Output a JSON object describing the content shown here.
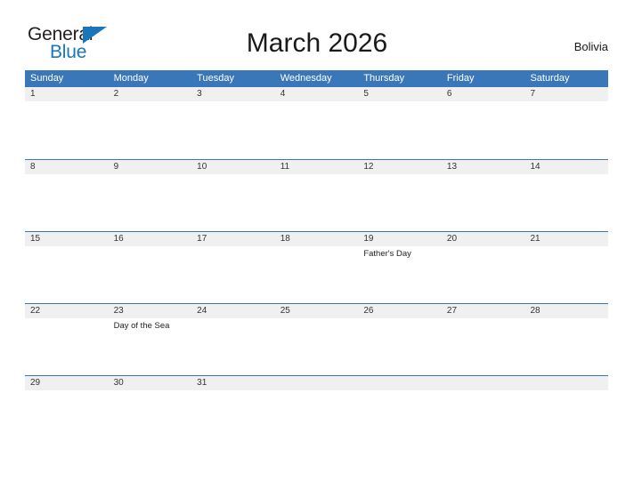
{
  "brand": {
    "name_top": "General",
    "name_bottom": "Blue",
    "accent_color": "#1b75bb",
    "flag_icon": "flag-triangle-icon"
  },
  "header": {
    "title": "March 2026",
    "country": "Bolivia"
  },
  "colors": {
    "header_blue": "#3a77b8",
    "row_line_blue": "#3a77b8",
    "date_band_gray": "#f0f0f0",
    "text_dark": "#1a1a1a"
  },
  "calendar": {
    "month": "March",
    "year": "2026",
    "weekdays": [
      "Sunday",
      "Monday",
      "Tuesday",
      "Wednesday",
      "Thursday",
      "Friday",
      "Saturday"
    ],
    "weeks": [
      [
        {
          "date": "1",
          "events": []
        },
        {
          "date": "2",
          "events": []
        },
        {
          "date": "3",
          "events": []
        },
        {
          "date": "4",
          "events": []
        },
        {
          "date": "5",
          "events": []
        },
        {
          "date": "6",
          "events": []
        },
        {
          "date": "7",
          "events": []
        }
      ],
      [
        {
          "date": "8",
          "events": []
        },
        {
          "date": "9",
          "events": []
        },
        {
          "date": "10",
          "events": []
        },
        {
          "date": "11",
          "events": []
        },
        {
          "date": "12",
          "events": []
        },
        {
          "date": "13",
          "events": []
        },
        {
          "date": "14",
          "events": []
        }
      ],
      [
        {
          "date": "15",
          "events": []
        },
        {
          "date": "16",
          "events": []
        },
        {
          "date": "17",
          "events": []
        },
        {
          "date": "18",
          "events": []
        },
        {
          "date": "19",
          "events": [
            "Father's Day"
          ]
        },
        {
          "date": "20",
          "events": []
        },
        {
          "date": "21",
          "events": []
        }
      ],
      [
        {
          "date": "22",
          "events": []
        },
        {
          "date": "23",
          "events": [
            "Day of the Sea"
          ]
        },
        {
          "date": "24",
          "events": []
        },
        {
          "date": "25",
          "events": []
        },
        {
          "date": "26",
          "events": []
        },
        {
          "date": "27",
          "events": []
        },
        {
          "date": "28",
          "events": []
        }
      ],
      [
        {
          "date": "29",
          "events": []
        },
        {
          "date": "30",
          "events": []
        },
        {
          "date": "31",
          "events": []
        },
        {
          "date": "",
          "events": []
        },
        {
          "date": "",
          "events": []
        },
        {
          "date": "",
          "events": []
        },
        {
          "date": "",
          "events": []
        }
      ]
    ]
  }
}
